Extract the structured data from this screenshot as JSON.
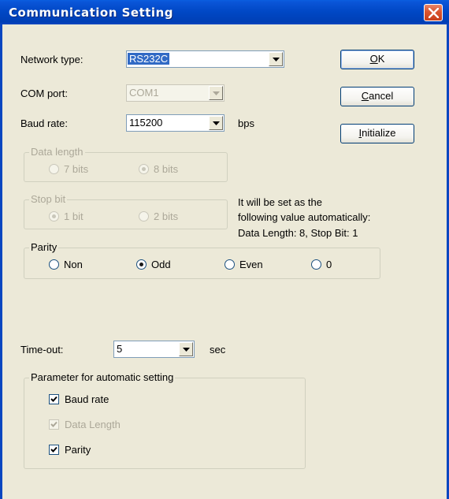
{
  "window": {
    "title": "Communication Setting"
  },
  "network_type": {
    "label": "Network type:",
    "value": "RS232C"
  },
  "com_port": {
    "label": "COM port:",
    "value": "COM1"
  },
  "baud_rate": {
    "label": "Baud rate:",
    "value": "115200",
    "unit": "bps"
  },
  "buttons": {
    "ok": "OK",
    "cancel": "Cancel",
    "initialize": "Initialize"
  },
  "data_length": {
    "legend": "Data length",
    "options": [
      "7 bits",
      "8 bits"
    ],
    "selected": "8 bits"
  },
  "stop_bit": {
    "legend": "Stop bit",
    "options": [
      "1 bit",
      "2 bits"
    ],
    "selected": "1 bit"
  },
  "auto_note": {
    "line1": "It will be set as the",
    "line2": "following value automatically:",
    "line3": "Data Length: 8, Stop Bit: 1"
  },
  "parity": {
    "legend": "Parity",
    "options": [
      "Non",
      "Odd",
      "Even",
      "0"
    ],
    "selected": "Odd"
  },
  "timeout": {
    "label": "Time-out:",
    "value": "5",
    "unit": "sec"
  },
  "auto_params": {
    "legend": "Parameter for automatic setting",
    "items": [
      {
        "label": "Baud rate",
        "checked": true,
        "enabled": true
      },
      {
        "label": "Data Length",
        "checked": true,
        "enabled": false
      },
      {
        "label": "Parity",
        "checked": true,
        "enabled": true
      }
    ]
  },
  "icons": {
    "close": "close-icon",
    "dropdown": "chevron-down-icon",
    "check": "checkmark-icon"
  }
}
